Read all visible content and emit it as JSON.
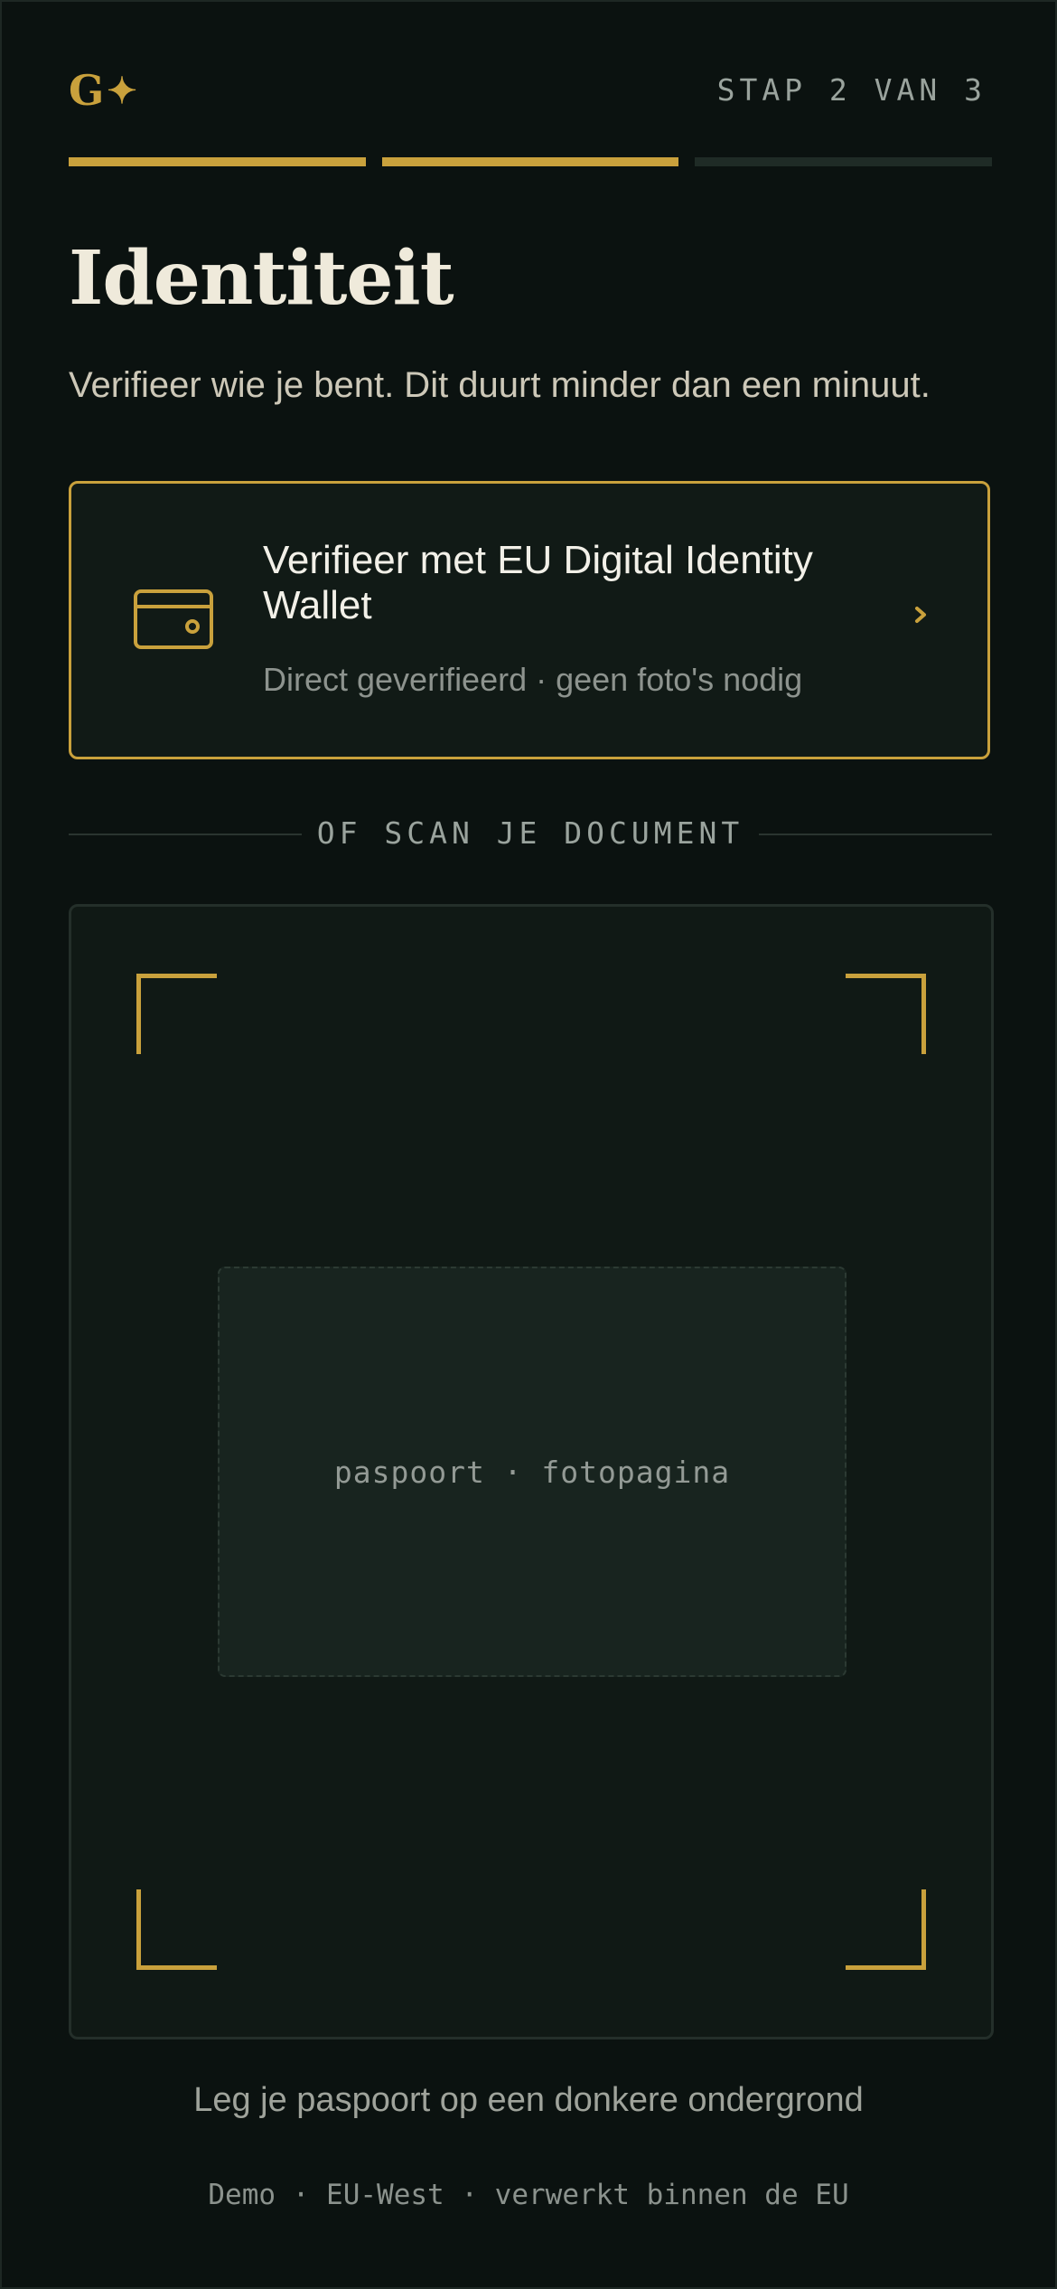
{
  "header": {
    "logo_text": "G",
    "logo_glyph": "✦",
    "step_label": "STAP 2 VAN 3"
  },
  "progress": {
    "current_step": 2,
    "total_steps": 3
  },
  "page": {
    "title": "Identiteit",
    "subtitle": "Verifieer wie je bent. Dit duurt minder dan een minuut."
  },
  "wallet_option": {
    "icon": "wallet-card-icon",
    "title": "Verifieer met EU Digital Identity Wallet",
    "subtitle": "Direct geverifieerd · geen foto's nodig",
    "chevron_icon": "chevron-right-icon"
  },
  "divider": {
    "label": "OF SCAN JE DOCUMENT"
  },
  "scanner": {
    "document_label": "paspoort · fotopagina"
  },
  "hint": "Leg je paspoort op een donkere ondergrond",
  "footer_note": "Demo · EU-West · verwerkt binnen de EU",
  "colors": {
    "accent": "#c9a13c",
    "background": "#0b1210",
    "card_background": "#111a16",
    "progress_inactive": "#1f2b26"
  }
}
